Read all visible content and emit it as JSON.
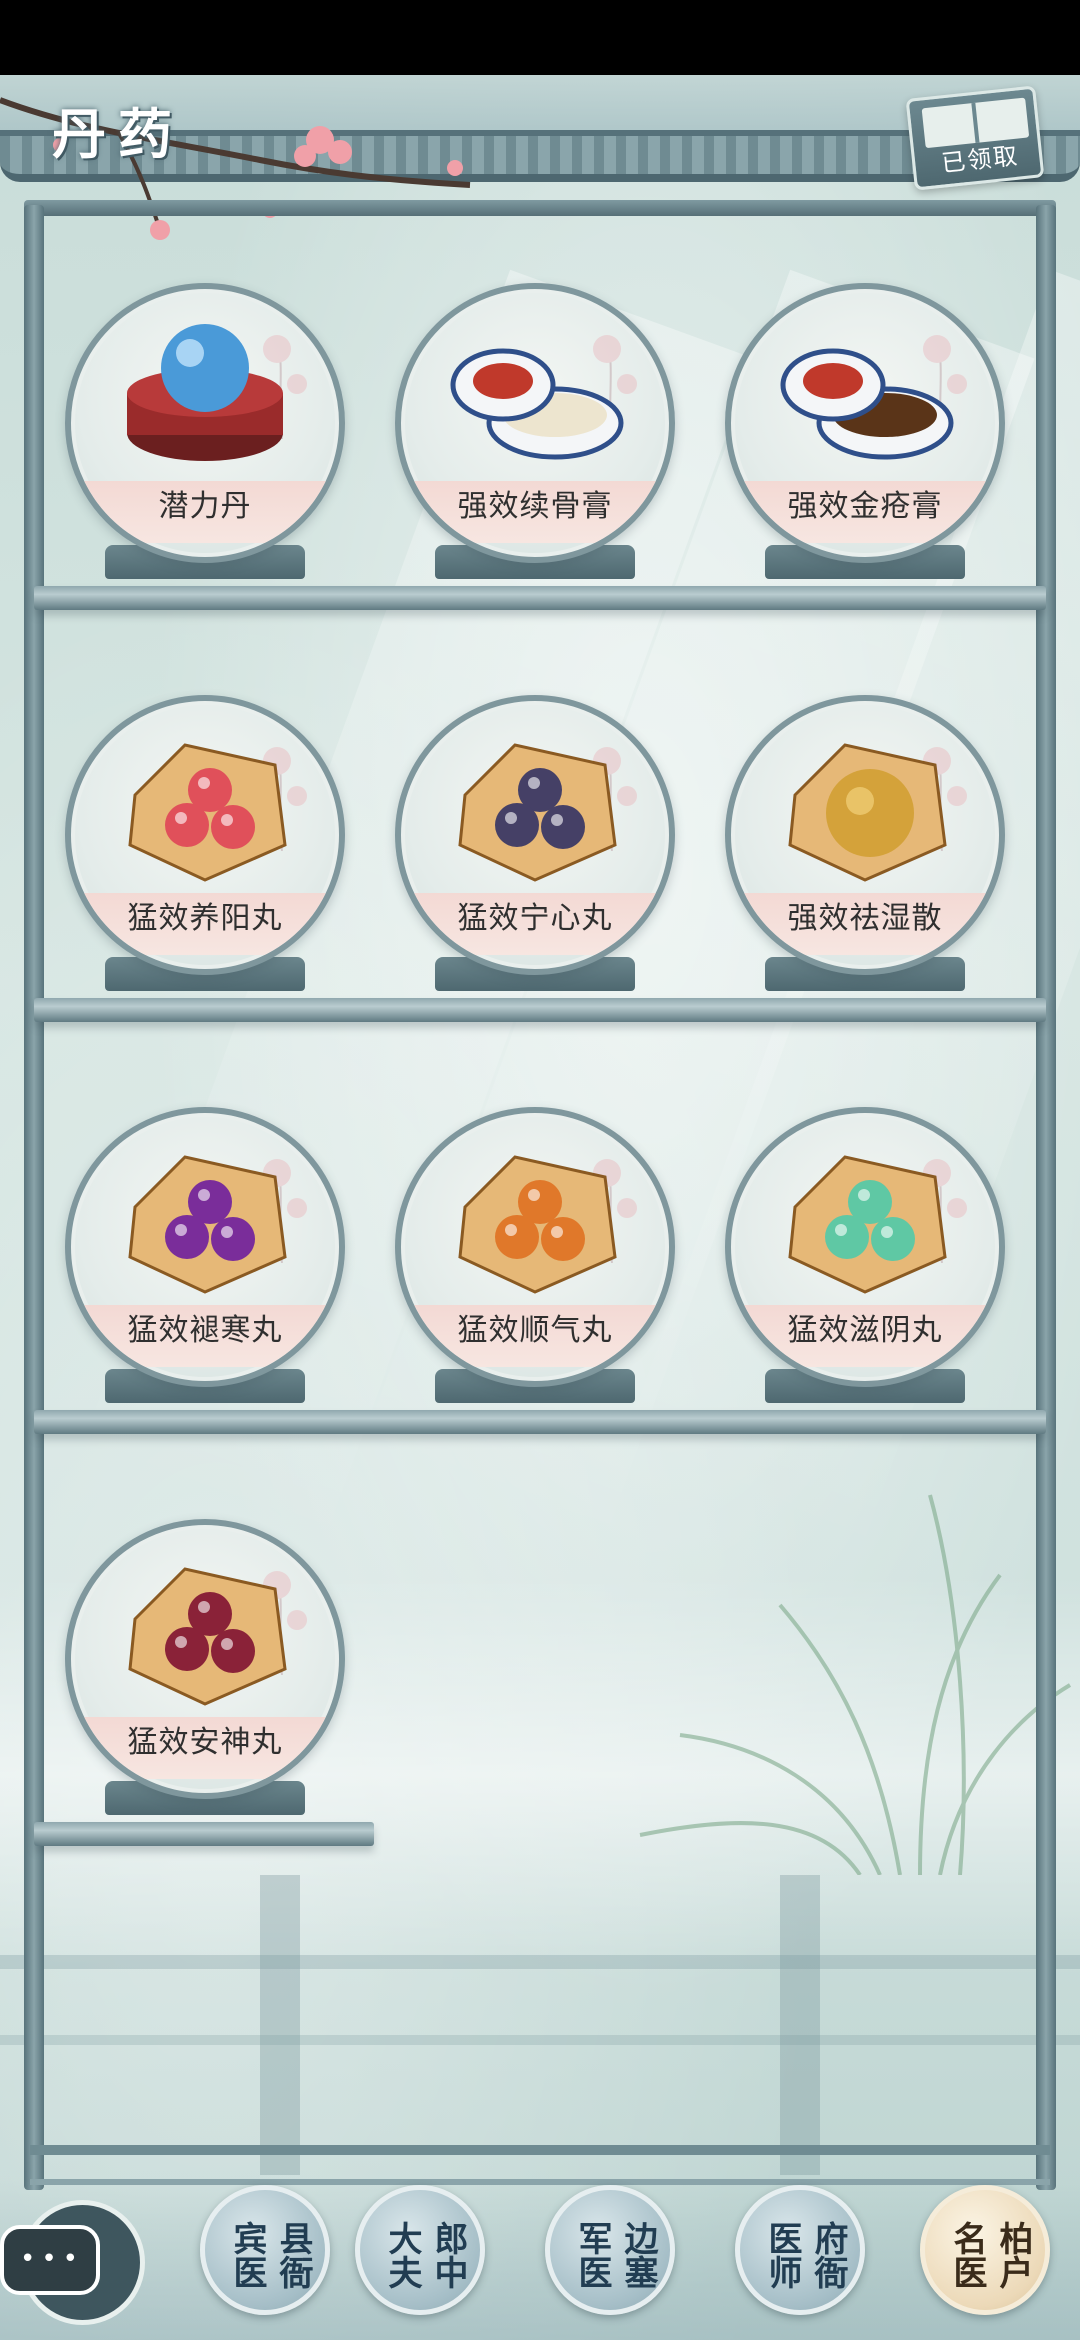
{
  "header": {
    "title": "丹药",
    "claimed_label": "已领取"
  },
  "items": [
    {
      "name": "潜力丹",
      "art": "pearl-box"
    },
    {
      "name": "强效续骨膏",
      "art": "porcelain-jar-white"
    },
    {
      "name": "强效金疮膏",
      "art": "porcelain-jar-brown"
    },
    {
      "name": "猛效养阳丸",
      "art": "pills",
      "pill_color": "#e0505a"
    },
    {
      "name": "猛效宁心丸",
      "art": "pills",
      "pill_color": "#454066"
    },
    {
      "name": "强效祛湿散",
      "art": "powder",
      "pill_color": "#d4a23a"
    },
    {
      "name": "猛效褪寒丸",
      "art": "pills",
      "pill_color": "#7a2d9a"
    },
    {
      "name": "猛效顺气丸",
      "art": "pills",
      "pill_color": "#e0782a"
    },
    {
      "name": "猛效滋阴丸",
      "art": "pills",
      "pill_color": "#5fc8a4"
    },
    {
      "name": "猛效安神丸",
      "art": "pills",
      "pill_color": "#8a2238"
    }
  ],
  "bottom_nav": [
    {
      "label": "县衙宾医",
      "active": false
    },
    {
      "label": "郎中大夫",
      "active": false
    },
    {
      "label": "边塞军医",
      "active": false
    },
    {
      "label": "府衙医师",
      "active": false
    },
    {
      "label": "柏户名医",
      "active": true
    }
  ],
  "colors": {
    "background": "#cfe1de",
    "shelf": "#5f7a82",
    "label_band": "#f3d9d4",
    "title_text": "#ffffff"
  },
  "icons": {
    "chat": "chat-bubble-icon",
    "claimed": "book-icon"
  }
}
